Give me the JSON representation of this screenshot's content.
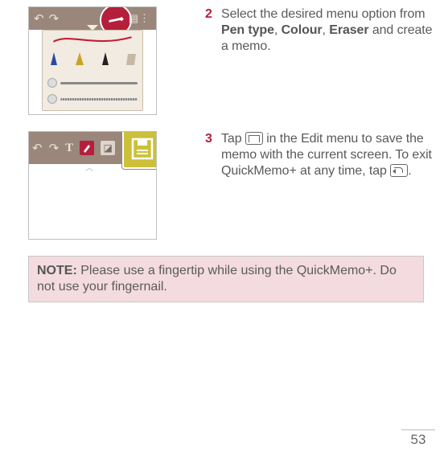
{
  "steps": {
    "s2": {
      "num": "2",
      "t1": "Select the desired menu option from ",
      "b1": "Pen type",
      "sep1": ", ",
      "b2": "Colour",
      "sep2": ", ",
      "b3": "Eraser",
      "t2": " and create a memo."
    },
    "s3": {
      "num": "3",
      "t1": "Tap ",
      "t2": " in the Edit menu to save the memo with the current screen. To exit QuickMemo+ at any time, tap ",
      "t3": "."
    }
  },
  "note": {
    "label": "NOTE:",
    "text": " Please use a fingertip while using the QuickMemo+. Do not use your fingernail."
  },
  "page": "53"
}
